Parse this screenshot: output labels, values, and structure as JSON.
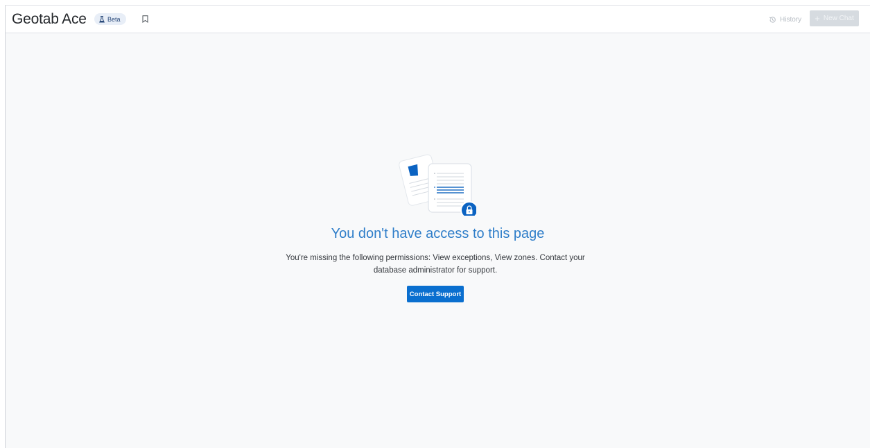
{
  "header": {
    "app_title": "Geotab Ace",
    "beta_label": "Beta",
    "history_label": "History",
    "new_chat_label": "New Chat",
    "icons": [
      "flask-icon",
      "bookmark-icon",
      "history-icon",
      "plus-icon"
    ]
  },
  "main": {
    "title": "You don't have access to this page",
    "message": "You're missing the following permissions: View exceptions, View zones. Contact your database administrator for support.",
    "contact_button_label": "Contact Support",
    "illustration": "locked-documents-illustration"
  },
  "colors": {
    "accent": "#0a6fcf",
    "title_blue": "#2f7ec9",
    "background": "#f8f9fa",
    "disabled_button": "#d6dbe0"
  }
}
